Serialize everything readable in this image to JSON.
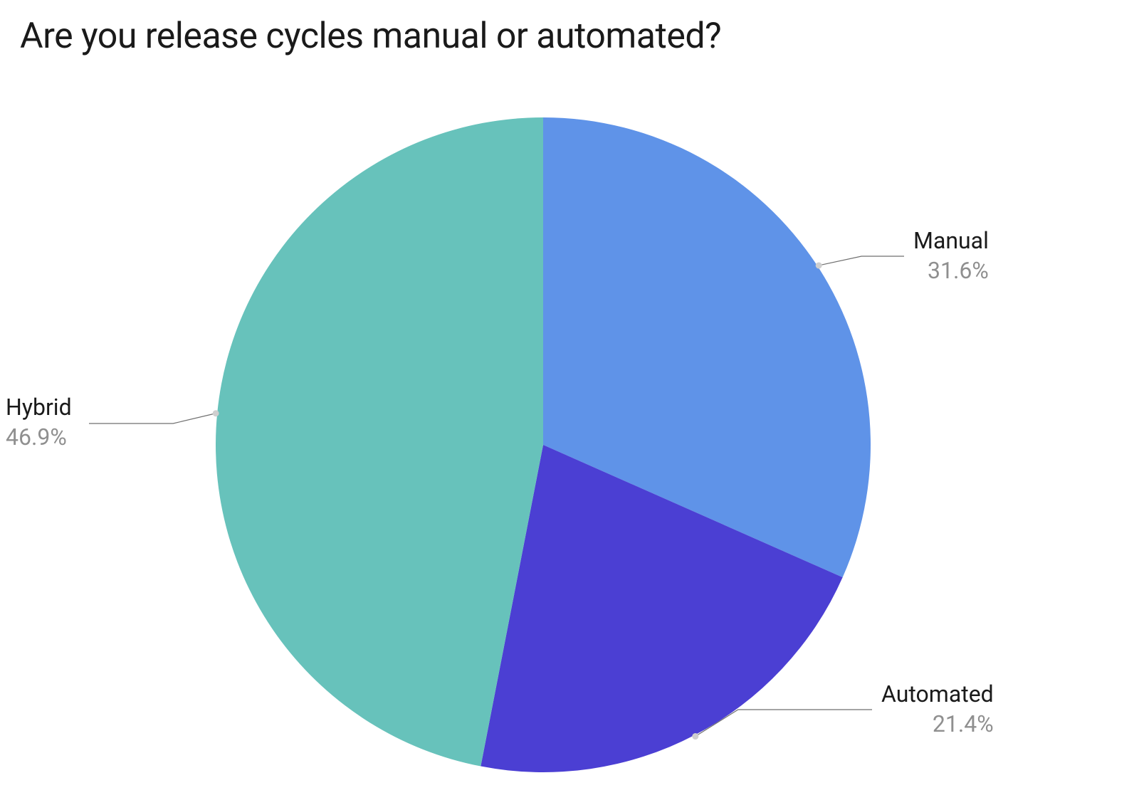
{
  "chart_data": {
    "type": "pie",
    "title": "Are you release cycles manual or automated?",
    "slices": [
      {
        "name": "Manual",
        "percent": 31.6,
        "color": "#5f93e8"
      },
      {
        "name": "Automated",
        "percent": 21.4,
        "color": "#4b3fd3"
      },
      {
        "name": "Hybrid",
        "percent": 46.9,
        "color": "#67c2bb"
      }
    ]
  },
  "labels": {
    "manual": {
      "name": "Manual",
      "pct": "31.6%"
    },
    "automated": {
      "name": "Automated",
      "pct": "21.4%"
    },
    "hybrid": {
      "name": "Hybrid",
      "pct": "46.9%"
    }
  }
}
